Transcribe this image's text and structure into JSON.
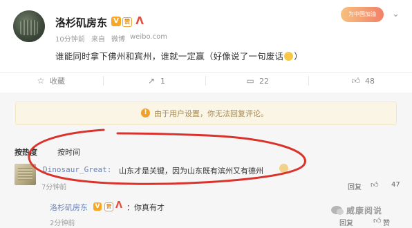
{
  "post": {
    "username": "洛杉矶房东",
    "badge_v": "V",
    "badge_member": "赞",
    "badge_red": "Λ",
    "time": "10分钟前",
    "from": "来自",
    "source": "微博",
    "domain": "weibo.com",
    "topic_badge": "为中国加油",
    "text": "谁能同时拿下佛州和宾州，谁就一定赢（好像说了一句废话",
    "text_end": "）"
  },
  "actions": {
    "favorite_label": "收藏",
    "share_count": "1",
    "comment_count": "22",
    "like_count": "48"
  },
  "notice": {
    "icon": "!",
    "text": "由于用户设置，你无法回复评论。"
  },
  "sort": {
    "hot": "按热度",
    "time": "按时间"
  },
  "comment": {
    "user": "Dinosaur_Great:",
    "text": "山东才是关键，因为山东既有滨州又有德州",
    "time": "7分钟前",
    "reply_label": "回复",
    "like_count": "47"
  },
  "reply": {
    "user": "洛杉矶房东",
    "badge_v": "V",
    "badge_member": "赞",
    "badge_red": "Λ",
    "text": "：你真有才",
    "time": "2分钟前",
    "reply_label": "回复",
    "like_label": "赞"
  },
  "watermark": "威康阅说",
  "colors": {
    "link_blue": "#6c84b8",
    "badge_orange": "#f7a823",
    "annotation_red": "#d9332b",
    "notice_bg": "#fbf5e6"
  }
}
